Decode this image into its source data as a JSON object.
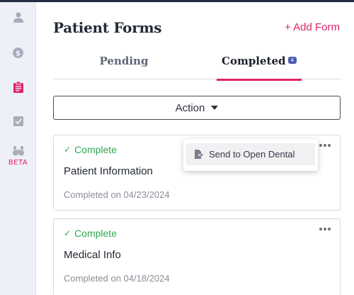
{
  "sidebar": {
    "items": [
      {
        "icon": "user-icon"
      },
      {
        "icon": "dollar-icon"
      },
      {
        "icon": "clipboard-icon",
        "active": true
      },
      {
        "icon": "checkbox-icon"
      },
      {
        "icon": "binoculars-icon",
        "label": "BETA"
      }
    ]
  },
  "header": {
    "title": "Patient Forms",
    "add_form_label": "+ Add Form"
  },
  "tabs": [
    {
      "label": "Pending"
    },
    {
      "label": "Completed",
      "badge": "4",
      "active": true
    }
  ],
  "action_button": {
    "label": "Action"
  },
  "menu": {
    "items": [
      {
        "label": "Send to Open Dental",
        "icon": "file-export-icon"
      }
    ]
  },
  "forms": [
    {
      "status": "Complete",
      "status_icon": "✓",
      "name": "Patient Information",
      "completed_on": "Completed on 04/23/2024"
    },
    {
      "status": "Complete",
      "status_icon": "✓",
      "name": "Medical Info",
      "completed_on": "Completed on 04/18/2024"
    }
  ],
  "colors": {
    "accent": "#e0246b",
    "success": "#2fa84f",
    "sidebar_bg": "#eef0f8",
    "badge": "#4a5fb0"
  }
}
